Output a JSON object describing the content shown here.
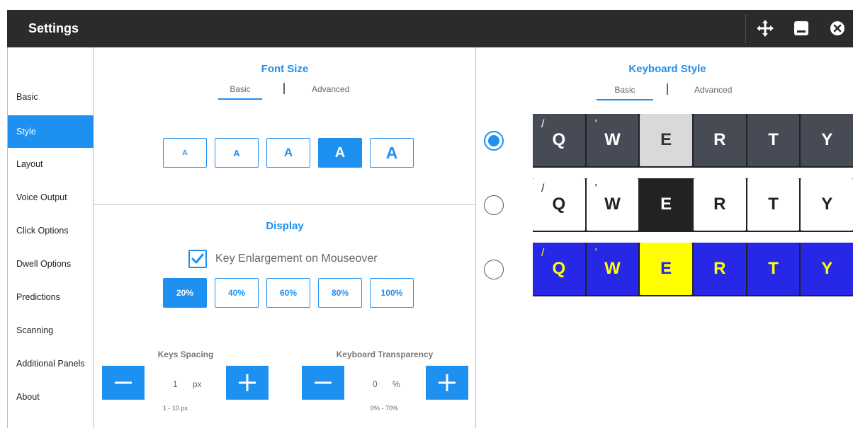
{
  "titlebar": {
    "title": "Settings"
  },
  "sidebar": {
    "items": [
      {
        "label": "Basic",
        "active": false
      },
      {
        "label": "Style",
        "active": true
      },
      {
        "label": "Layout",
        "active": false
      },
      {
        "label": "Voice Output",
        "active": false
      },
      {
        "label": "Click Options",
        "active": false
      },
      {
        "label": "Dwell Options",
        "active": false
      },
      {
        "label": "Predictions",
        "active": false
      },
      {
        "label": "Scanning",
        "active": false
      },
      {
        "label": "Additional Panels",
        "active": false
      },
      {
        "label": "About",
        "active": false
      }
    ]
  },
  "font_size": {
    "title": "Font Size",
    "tabs": [
      "Basic",
      "Advanced"
    ],
    "active_tab": "Basic",
    "buttons": [
      "A",
      "A",
      "A",
      "A",
      "A"
    ],
    "selected_index": 3
  },
  "display": {
    "title": "Display",
    "key_enlargement": {
      "label": "Key Enlargement on Mouseover",
      "checked": true
    },
    "enlargement_options": [
      "20%",
      "40%",
      "60%",
      "80%",
      "100%"
    ],
    "selected_enlargement": "20%",
    "keys_spacing": {
      "label": "Keys Spacing",
      "value": "1",
      "unit": "px",
      "range": "1 - 10 px"
    },
    "keyboard_transparency": {
      "label": "Keyboard Transparency",
      "value": "0",
      "unit": "%",
      "range": "0% - 70%"
    }
  },
  "keyboard_style": {
    "title": "Keyboard Style",
    "tabs": [
      "Basic",
      "Advanced"
    ],
    "active_tab": "Basic",
    "styles": [
      {
        "selected": true,
        "keys": [
          "Q",
          "W",
          "E",
          "R",
          "T",
          "Y"
        ],
        "sup": [
          "/",
          "'",
          "",
          "",
          "",
          ""
        ]
      },
      {
        "selected": false,
        "keys": [
          "Q",
          "W",
          "E",
          "R",
          "T",
          "Y"
        ],
        "sup": [
          "/",
          "'",
          "",
          "",
          "",
          ""
        ]
      },
      {
        "selected": false,
        "keys": [
          "Q",
          "W",
          "E",
          "R",
          "T",
          "Y"
        ],
        "sup": [
          "/",
          "'",
          "",
          "",
          "",
          ""
        ]
      }
    ]
  },
  "colors": {
    "accent": "#1e90f0",
    "titlebar": "#2b2b2b"
  }
}
